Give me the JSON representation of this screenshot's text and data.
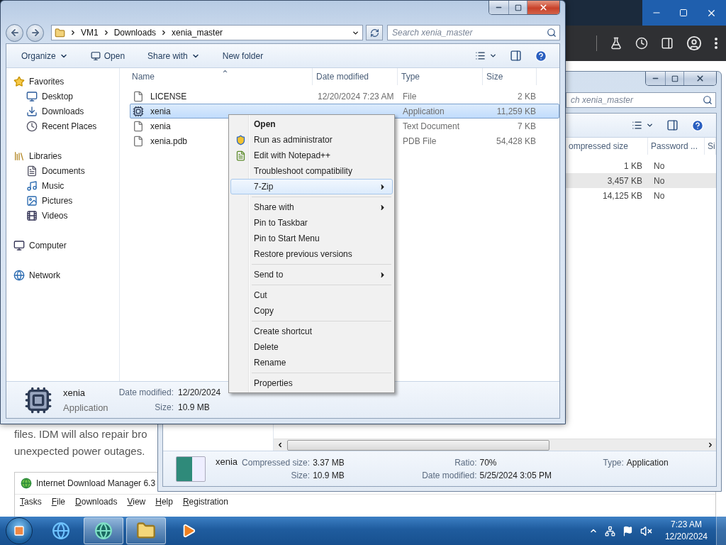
{
  "web_page": {
    "paragraph_lines": [
      "files. IDM will also repair bro",
      "unexpected power outages."
    ]
  },
  "idm_window": {
    "title": "Internet Download Manager 6.3",
    "menu": [
      "Tasks",
      "File",
      "Downloads",
      "View",
      "Help",
      "Registration"
    ]
  },
  "archive_window": {
    "search_placeholder": "ch xenia_master",
    "columns": [
      "ompressed size",
      "Password ...",
      "Si"
    ],
    "rows": [
      {
        "compressed_size": "1 KB",
        "password": "No",
        "selected": false
      },
      {
        "compressed_size": "3,457 KB",
        "password": "No",
        "selected": true
      },
      {
        "compressed_size": "14,125 KB",
        "password": "No",
        "selected": false
      }
    ],
    "details": {
      "name": "xenia",
      "fields": [
        {
          "label": "Compressed size:",
          "value": "3.37 MB"
        },
        {
          "label": "Ratio:",
          "value": "70%"
        },
        {
          "label": "Type:",
          "value": "Application"
        },
        {
          "label": "Size:",
          "value": "10.9 MB"
        },
        {
          "label": "Date modified:",
          "value": "5/25/2024 3:05 PM"
        }
      ]
    }
  },
  "explorer": {
    "breadcrumb": [
      "VM1",
      "Downloads",
      "xenia_master"
    ],
    "search_placeholder": "Search xenia_master",
    "toolbar": [
      {
        "label": "Organize",
        "kind": "menu"
      },
      {
        "label": "Open",
        "kind": "open"
      },
      {
        "label": "Share with",
        "kind": "menu"
      },
      {
        "label": "New folder",
        "kind": "plain"
      }
    ],
    "nav": [
      {
        "label": "Favorites",
        "kind": "favorites",
        "children": [
          {
            "label": "Desktop",
            "kind": "desktop"
          },
          {
            "label": "Downloads",
            "kind": "downloads"
          },
          {
            "label": "Recent Places",
            "kind": "recent"
          }
        ]
      },
      {
        "label": "Libraries",
        "kind": "libraries",
        "children": [
          {
            "label": "Documents",
            "kind": "documents"
          },
          {
            "label": "Music",
            "kind": "music"
          },
          {
            "label": "Pictures",
            "kind": "pictures"
          },
          {
            "label": "Videos",
            "kind": "videos"
          }
        ]
      },
      {
        "label": "Computer",
        "kind": "computer"
      },
      {
        "label": "Network",
        "kind": "network"
      }
    ],
    "columns": [
      "Name",
      "Date modified",
      "Type",
      "Size"
    ],
    "files": [
      {
        "name": "LICENSE",
        "kind": "text",
        "date": "12/20/2024 7:23 AM",
        "type": "File",
        "size": "2 KB",
        "selected": false
      },
      {
        "name": "xenia",
        "kind": "app",
        "type": "Application",
        "size": "11,259 KB",
        "selected": true
      },
      {
        "name": "xenia",
        "kind": "text",
        "type": "Text Document",
        "size": "7 KB",
        "selected": false
      },
      {
        "name": "xenia.pdb",
        "kind": "text",
        "type": "PDB File",
        "size": "54,428 KB",
        "selected": false
      }
    ],
    "details": {
      "name": "xenia",
      "type": "Application",
      "fields": [
        {
          "label": "Date modified:",
          "value": "12/20/2024"
        },
        {
          "label": "Size:",
          "value": "10.9 MB"
        }
      ]
    }
  },
  "context_menu": {
    "items": [
      {
        "kind": "item",
        "label": "Open",
        "default": true,
        "submenu": false,
        "selected": false
      },
      {
        "kind": "elevated",
        "label": "Run as administrator",
        "default": false,
        "submenu": false,
        "selected": false
      },
      {
        "kind": "editor",
        "label": "Edit with Notepad++",
        "default": false,
        "submenu": false,
        "selected": false
      },
      {
        "kind": "item",
        "label": "Troubleshoot compatibility",
        "default": false,
        "submenu": false,
        "selected": false
      },
      {
        "kind": "item",
        "label": "7-Zip",
        "default": false,
        "submenu": true,
        "selected": true
      },
      {
        "kind": "separator"
      },
      {
        "kind": "item",
        "label": "Share with",
        "default": false,
        "submenu": true,
        "selected": false
      },
      {
        "kind": "item",
        "label": "Pin to Taskbar",
        "default": false,
        "submenu": false,
        "selected": false
      },
      {
        "kind": "item",
        "label": "Pin to Start Menu",
        "default": false,
        "submenu": false,
        "selected": false
      },
      {
        "kind": "item",
        "label": "Restore previous versions",
        "default": false,
        "submenu": false,
        "selected": false
      },
      {
        "kind": "separator"
      },
      {
        "kind": "item",
        "label": "Send to",
        "default": false,
        "submenu": true,
        "selected": false
      },
      {
        "kind": "separator"
      },
      {
        "kind": "item",
        "label": "Cut",
        "default": false,
        "submenu": false,
        "selected": false
      },
      {
        "kind": "item",
        "label": "Copy",
        "default": false,
        "submenu": false,
        "selected": false
      },
      {
        "kind": "separator"
      },
      {
        "kind": "item",
        "label": "Create shortcut",
        "default": false,
        "submenu": false,
        "selected": false
      },
      {
        "kind": "item",
        "label": "Delete",
        "default": false,
        "submenu": false,
        "selected": false
      },
      {
        "kind": "item",
        "label": "Rename",
        "default": false,
        "submenu": false,
        "selected": false
      },
      {
        "kind": "separator"
      },
      {
        "kind": "item",
        "label": "Properties",
        "default": false,
        "submenu": false,
        "selected": false
      }
    ]
  },
  "taskbar": {
    "apps": [
      {
        "kind": "browser",
        "active": false
      },
      {
        "kind": "app",
        "active": true
      },
      {
        "kind": "explorer",
        "active": true
      },
      {
        "kind": "media",
        "active": false
      }
    ],
    "muted": true,
    "time": "7:23 AM",
    "date": "12/20/2024"
  }
}
